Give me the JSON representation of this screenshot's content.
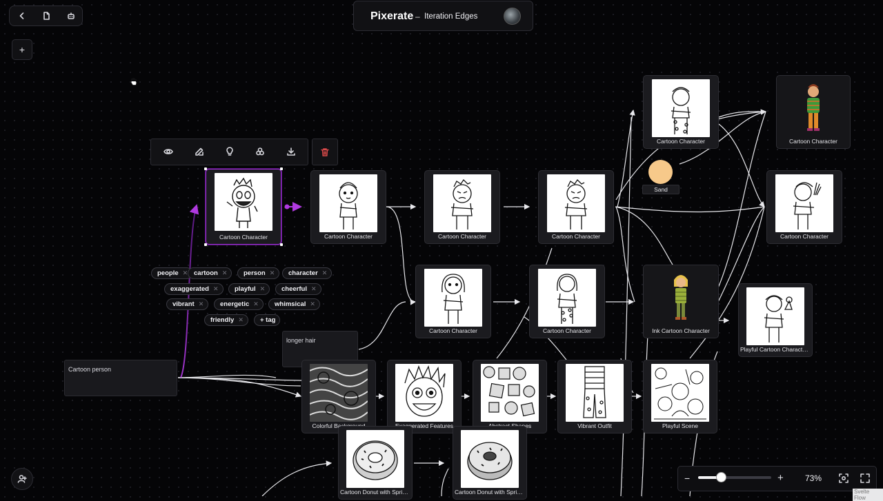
{
  "app": {
    "name": "Pixerate",
    "separator": "–",
    "page_title": "Iteration Edges"
  },
  "toolbar_left": {
    "icons": [
      "back-icon",
      "document-icon",
      "bot-icon"
    ],
    "add_label": "+"
  },
  "node_toolbar": {
    "icons": [
      "eye-icon",
      "edit-icon",
      "lightbulb-icon",
      "variations-icon",
      "download-icon",
      "trash-icon"
    ]
  },
  "nodes": {
    "selected": "Cartoon Character",
    "row1_a": "Cartoon Character",
    "row1_b": "Cartoon Character",
    "row1_c": "Cartoon Character",
    "top_a": "Cartoon Character",
    "top_b": "Cartoon Character",
    "right_a": "Cartoon Character",
    "row2_a": "Cartoon Character",
    "row2_b": "Cartoon Character",
    "row2_c": "Ink Cartoon Character",
    "row2_d": "Playful Cartoon Character...",
    "row3_a": "Colorful Background",
    "row3_b": "Exaggerated Features",
    "row3_c": "Abstract Shapes",
    "row3_d": "Vibrant Outfit",
    "row3_e": "Playful Scene",
    "row4_a": "Cartoon Donut with Sprin...",
    "row4_b": "Cartoon Donut with Sprin..."
  },
  "sand": {
    "label": "Sand",
    "color": "#f7c98a"
  },
  "tags": [
    "people",
    "cartoon",
    "person",
    "character",
    "exaggerated",
    "playful",
    "cheerful",
    "vibrant",
    "energetic",
    "whimsical",
    "friendly"
  ],
  "add_tag_label": "+ tag",
  "text_nodes": {
    "prompt": "Cartoon person",
    "modifier": "longer hair"
  },
  "zoom": {
    "level": "73%",
    "fraction": 0.31,
    "minus": "−",
    "plus": "+"
  },
  "watermark": "Svelte Flow",
  "colors": {
    "accent": "#9b2fd1",
    "background": "#050507",
    "edge": "#e8e8ec"
  }
}
